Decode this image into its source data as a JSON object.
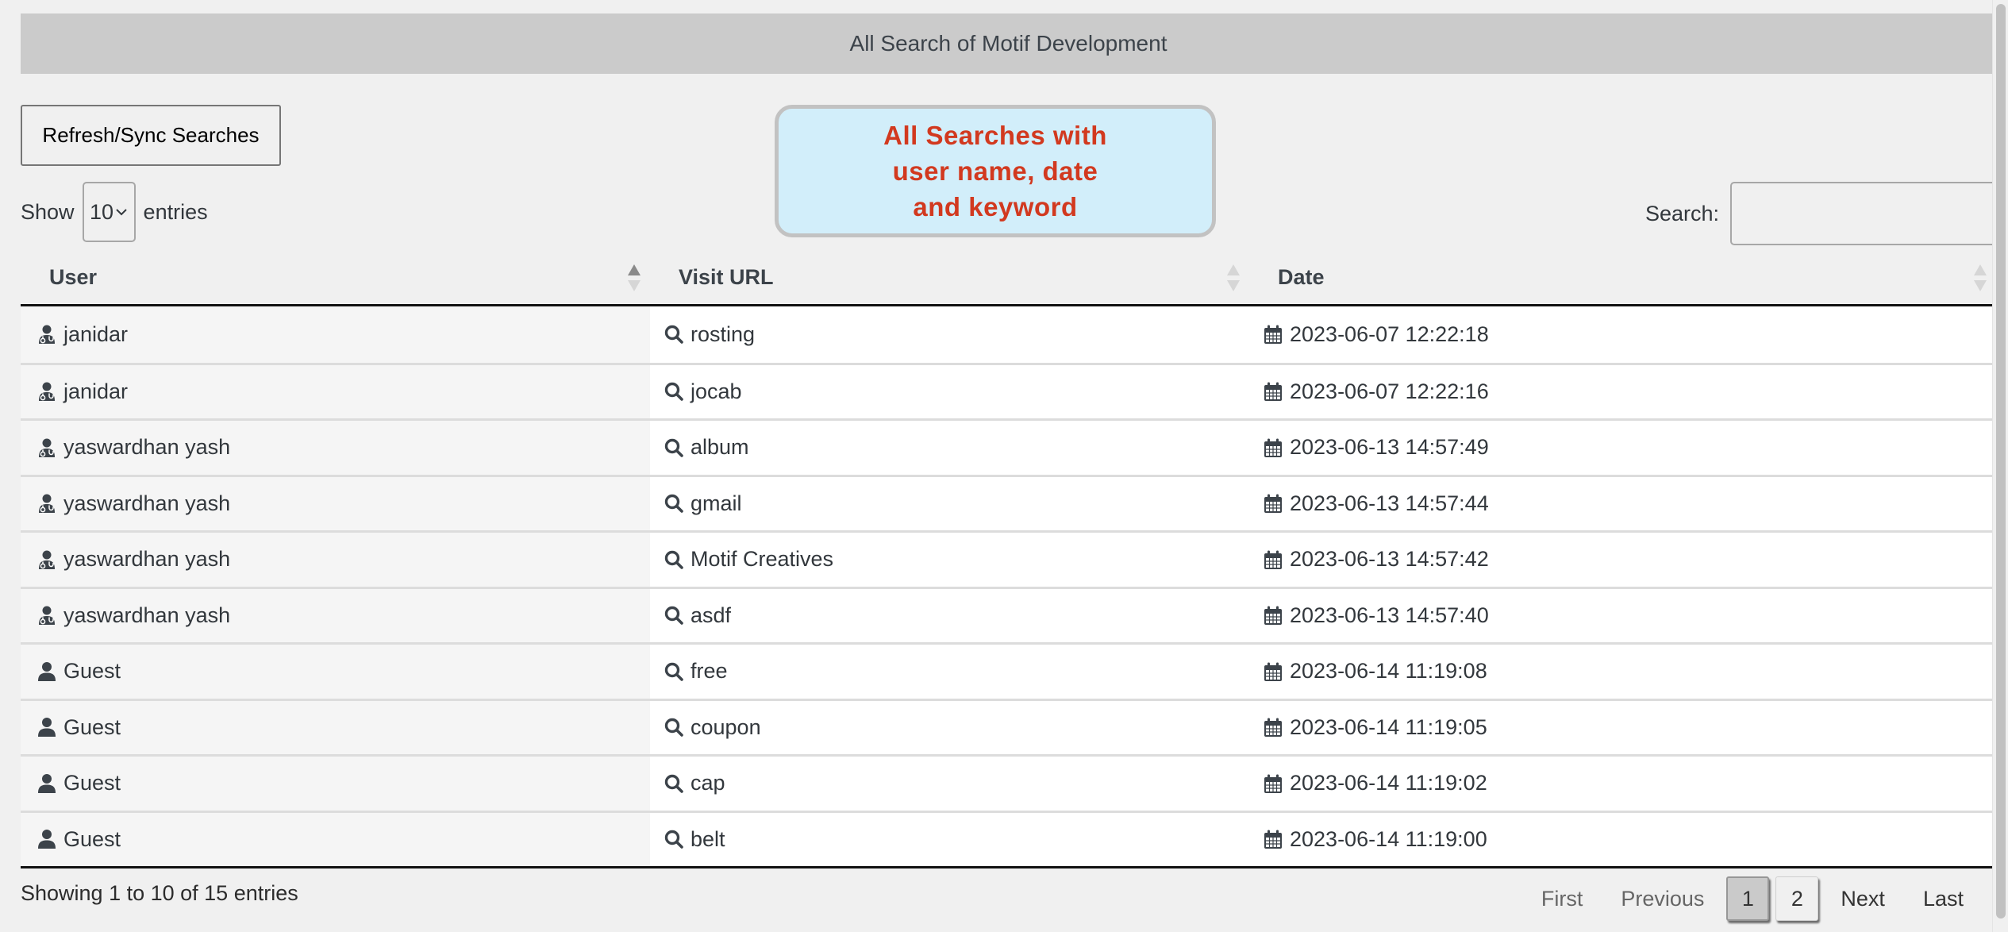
{
  "header": {
    "title": "All Search of Motif Development"
  },
  "toolbar": {
    "refresh_label": "Refresh/Sync Searches"
  },
  "callout": {
    "lines": [
      "All Searches with",
      "user name, date",
      "and keyword"
    ],
    "text_color": "#d2391f",
    "bg_color": "#d2eefa"
  },
  "length": {
    "show_label": "Show",
    "selected": "10",
    "entries_label": "entries"
  },
  "search": {
    "label": "Search:",
    "value": "",
    "placeholder": ""
  },
  "table": {
    "columns": [
      {
        "label": "User",
        "sort": "ascending"
      },
      {
        "label": "Visit URL",
        "sort": "none"
      },
      {
        "label": "Date",
        "sort": "none"
      }
    ],
    "rows": [
      {
        "user": "janidar",
        "user_icon": "user-doctor-icon",
        "keyword": "rosting",
        "date": "2023-06-07 12:22:18"
      },
      {
        "user": "janidar",
        "user_icon": "user-doctor-icon",
        "keyword": "jocab",
        "date": "2023-06-07 12:22:16"
      },
      {
        "user": "yaswardhan yash",
        "user_icon": "user-doctor-icon",
        "keyword": "album",
        "date": "2023-06-13 14:57:49"
      },
      {
        "user": "yaswardhan yash",
        "user_icon": "user-doctor-icon",
        "keyword": "gmail",
        "date": "2023-06-13 14:57:44"
      },
      {
        "user": "yaswardhan yash",
        "user_icon": "user-doctor-icon",
        "keyword": "Motif Creatives",
        "date": "2023-06-13 14:57:42"
      },
      {
        "user": "yaswardhan yash",
        "user_icon": "user-doctor-icon",
        "keyword": "asdf",
        "date": "2023-06-13 14:57:40"
      },
      {
        "user": "Guest",
        "user_icon": "user-icon",
        "keyword": "free",
        "date": "2023-06-14 11:19:08"
      },
      {
        "user": "Guest",
        "user_icon": "user-icon",
        "keyword": "coupon",
        "date": "2023-06-14 11:19:05"
      },
      {
        "user": "Guest",
        "user_icon": "user-icon",
        "keyword": "cap",
        "date": "2023-06-14 11:19:02"
      },
      {
        "user": "Guest",
        "user_icon": "user-icon",
        "keyword": "belt",
        "date": "2023-06-14 11:19:00"
      }
    ]
  },
  "footer": {
    "info": "Showing 1 to 10 of 15 entries",
    "pagination": {
      "first": "First",
      "previous": "Previous",
      "pages": [
        "1",
        "2"
      ],
      "current": "1",
      "next": "Next",
      "last": "Last"
    }
  }
}
